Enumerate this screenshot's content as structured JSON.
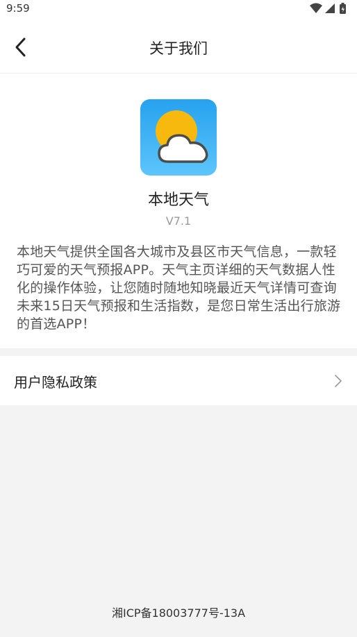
{
  "status_bar": {
    "time": "9:59",
    "icons": [
      "wifi-icon",
      "signal-icon",
      "battery-icon"
    ]
  },
  "header": {
    "back_icon": "chevron-left-icon",
    "title": "关于我们"
  },
  "about": {
    "icon": "sun-cloud-weather-icon",
    "app_name": "本地天气",
    "version": "V7.1",
    "description": "本地天气提供全国各大城市及县区市天气信息，一款轻巧可爱的天气预报APP。天气主页详细的天气数据人性化的操作体验，让您随时随地知晓最近天气详情可查询未来15日天气预报和生活指数，是您日常生活出行旅游的首选APP！"
  },
  "privacy": {
    "label": "用户隐私政策",
    "chevron_icon": "chevron-right-icon"
  },
  "footer": {
    "icp": "湘ICP备18003777号-13A"
  },
  "colors": {
    "icon_bg_top": "#2aa6ee",
    "icon_bg_bottom": "#5cc4fb",
    "sun": "#f8b90f",
    "page_bg": "#f3f3f3"
  }
}
